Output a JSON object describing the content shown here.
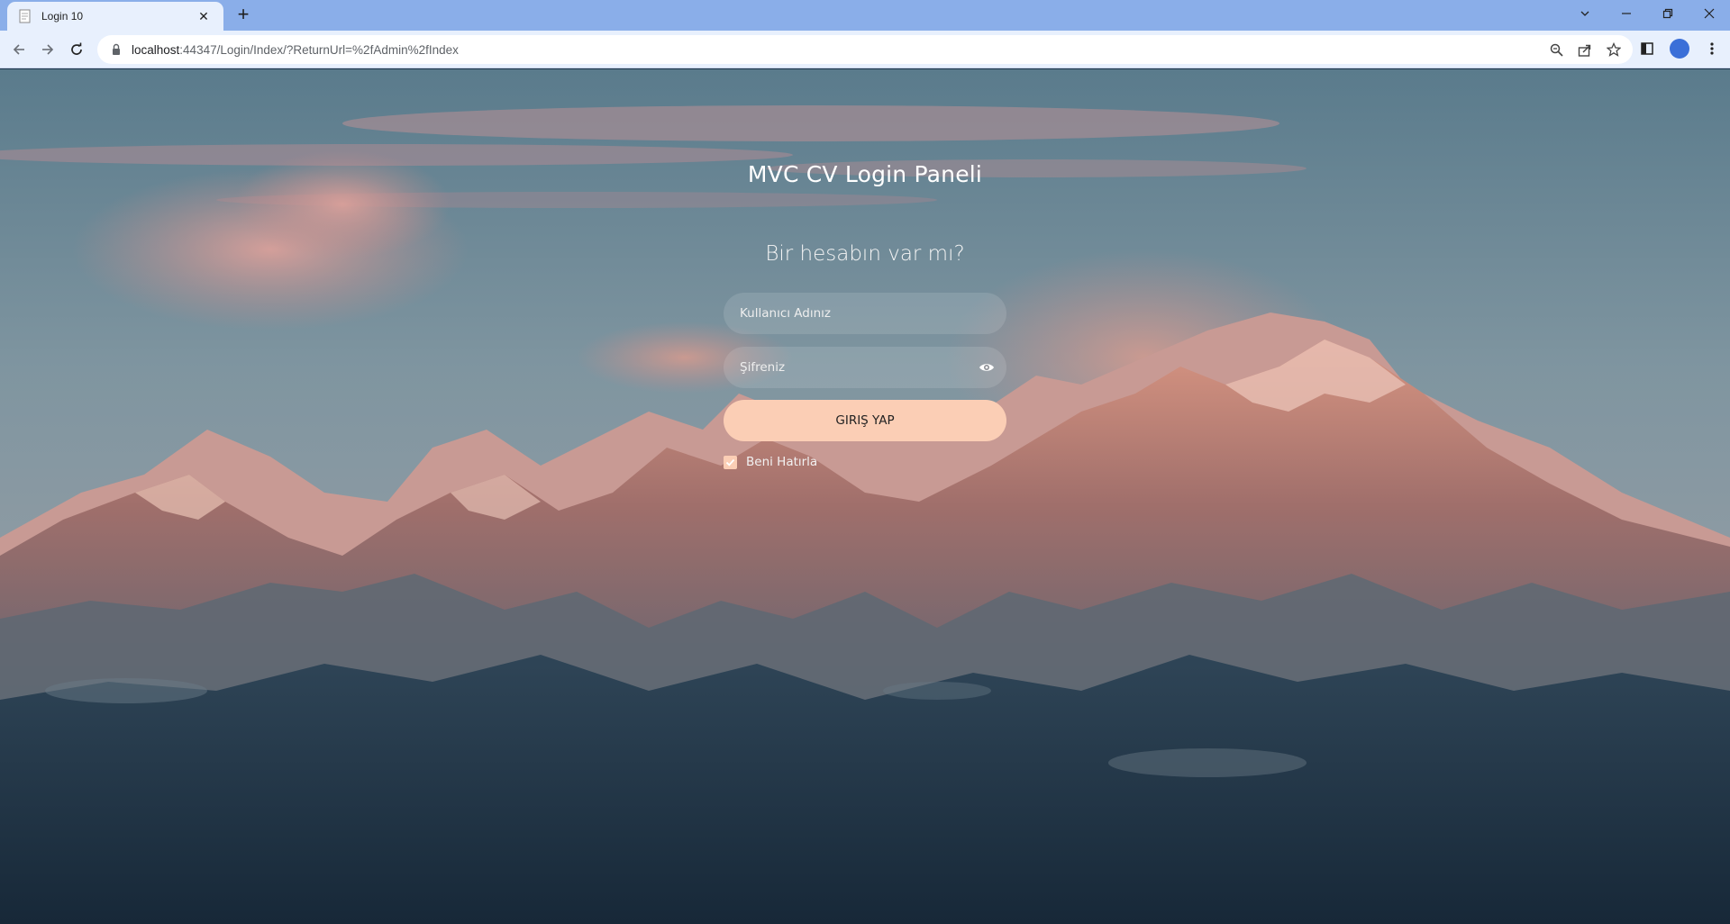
{
  "browser": {
    "tab_title": "Login 10",
    "tab_close": "✕",
    "new_tab": "+",
    "url_host": "localhost",
    "url_path": ":44347/Login/Index/?ReturnUrl=%2fAdmin%2fIndex",
    "icons": [
      "back-arrow-icon",
      "forward-arrow-icon",
      "reload-icon",
      "lock-icon",
      "zoom-icon",
      "share-icon",
      "star-icon",
      "side-panel-icon",
      "profile-avatar",
      "menu-icon"
    ]
  },
  "login": {
    "title": "MVC CV Login Paneli",
    "subtitle": "Bir hesabın var mı?",
    "username_placeholder": "Kullanıcı Adınız",
    "password_placeholder": "Şifreniz",
    "submit_label": "GIRIŞ YAP",
    "remember_label": "Beni Hatırla",
    "remember_checked": true
  },
  "colors": {
    "accent": "#fbceb5",
    "tabstrip": "#8aaee9",
    "toolbar": "#e8f0fd"
  }
}
